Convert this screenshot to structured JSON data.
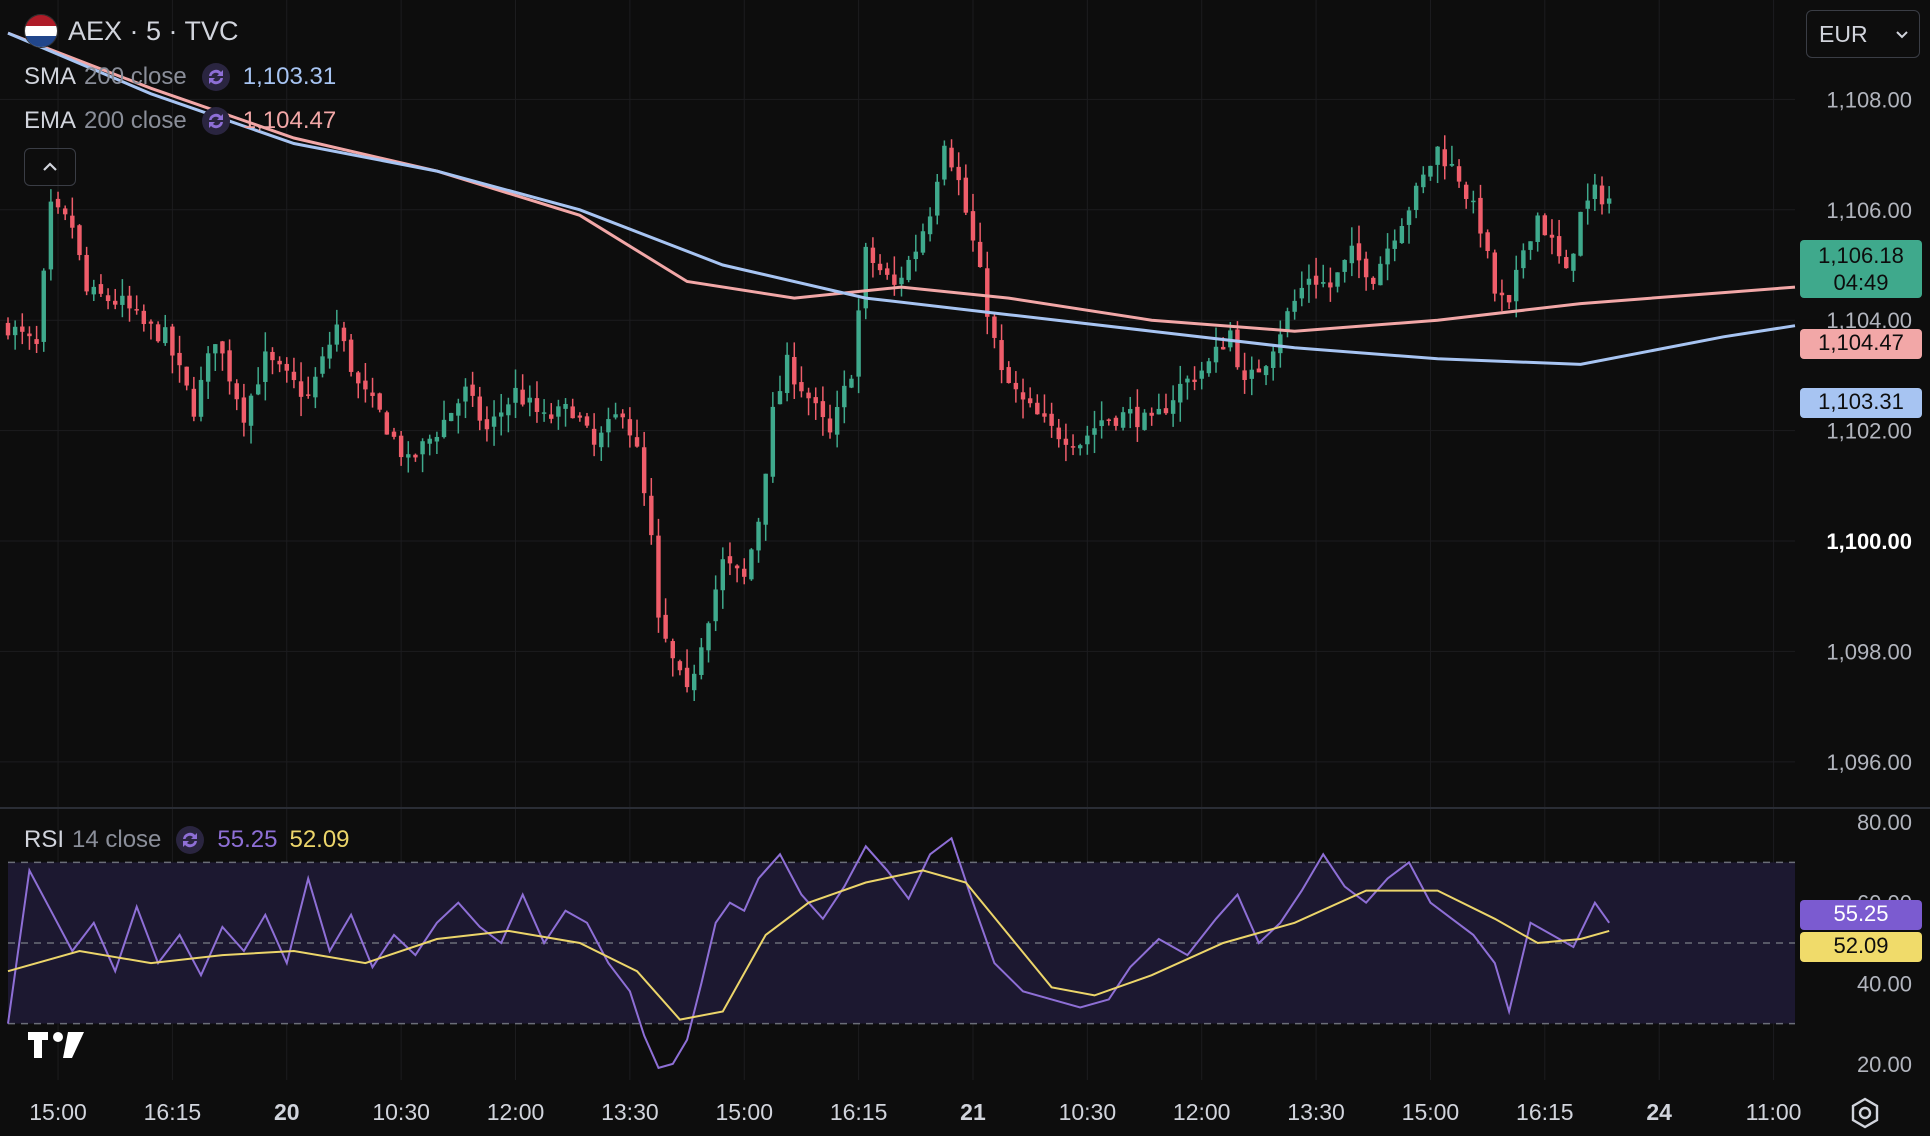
{
  "header": {
    "symbol_title": "AEX · 5 · TVC",
    "flag_icon": "netherlands-flag-icon",
    "currency_label": "EUR"
  },
  "indicators": {
    "sma": {
      "name": "SMA",
      "params": "200 close",
      "value": "1,103.31",
      "color": "#a7c4f2"
    },
    "ema": {
      "name": "EMA",
      "params": "200 close",
      "value": "1,104.47",
      "color": "#f2a7a7"
    },
    "rsi": {
      "name": "RSI",
      "params": "14 close",
      "value": "55.25",
      "ma_value": "52.09",
      "color": "#8e6fd6",
      "ma_color": "#ecd56a"
    }
  },
  "price_tags": {
    "last_price": "1,106.18",
    "countdown": "04:49",
    "ema": "1,104.47",
    "sma": "1,103.31",
    "rsi": "55.25",
    "rsi_ma": "52.09"
  },
  "colors": {
    "up": "#3fa98c",
    "down": "#ef5d6a",
    "sma": "#a7c4f2",
    "ema": "#f2a7a7",
    "rsi": "#8e6fd6",
    "rsi_ma": "#ecd56a",
    "background": "#0d0d0d",
    "grid": "#1c1c1f"
  },
  "chart_data": [
    {
      "type": "candlestick",
      "title": "AEX · 5 · TVC",
      "y_axis": {
        "ylim": [
          1095.2,
          1109.8
        ],
        "ticks": [
          "1,096.00",
          "1,098.00",
          "1,100.00",
          "1,102.00",
          "1,104.00",
          "1,106.00",
          "1,108.00"
        ],
        "tick_values": [
          1096,
          1098,
          1100,
          1102,
          1104,
          1106,
          1108
        ],
        "bold_tick": "1,100.00"
      },
      "x_axis": {
        "ticks": [
          "15:00",
          "16:15",
          "20",
          "10:30",
          "12:00",
          "13:30",
          "15:00",
          "16:15",
          "21",
          "10:30",
          "12:00",
          "13:30",
          "15:00",
          "16:15",
          "24",
          "11:00"
        ],
        "tick_positions": [
          7,
          23,
          39,
          55,
          71,
          87,
          103,
          119,
          135,
          151,
          167,
          183,
          199,
          215,
          231,
          247
        ],
        "bold_ticks": [
          "20",
          "21",
          "24"
        ]
      },
      "ohlc_close_path": [
        [
          0,
          1103.9
        ],
        [
          4,
          1103.5
        ],
        [
          6,
          1106.0
        ],
        [
          9,
          1105.7
        ],
        [
          11,
          1104.5
        ],
        [
          16,
          1104.3
        ],
        [
          19,
          1103.9
        ],
        [
          22,
          1103.7
        ],
        [
          26,
          1102.4
        ],
        [
          29,
          1103.7
        ],
        [
          33,
          1102.3
        ],
        [
          36,
          1103.3
        ],
        [
          42,
          1102.6
        ],
        [
          46,
          1103.9
        ],
        [
          49,
          1102.8
        ],
        [
          52,
          1102.3
        ],
        [
          56,
          1101.4
        ],
        [
          60,
          1102.0
        ],
        [
          64,
          1102.7
        ],
        [
          67,
          1102.0
        ],
        [
          71,
          1102.7
        ],
        [
          75,
          1102.2
        ],
        [
          79,
          1102.4
        ],
        [
          82,
          1101.7
        ],
        [
          86,
          1102.4
        ],
        [
          88,
          1101.6
        ],
        [
          90,
          1100.0
        ],
        [
          91,
          1098.5
        ],
        [
          93,
          1097.8
        ],
        [
          95,
          1097.2
        ],
        [
          97,
          1098.2
        ],
        [
          100,
          1099.6
        ],
        [
          103,
          1099.3
        ],
        [
          105,
          1100.4
        ],
        [
          107,
          1102.3
        ],
        [
          109,
          1103.2
        ],
        [
          112,
          1102.6
        ],
        [
          115,
          1101.9
        ],
        [
          118,
          1103.1
        ],
        [
          120,
          1105.2
        ],
        [
          124,
          1104.6
        ],
        [
          127,
          1105.3
        ],
        [
          129,
          1106.0
        ],
        [
          131,
          1107.3
        ],
        [
          133,
          1106.5
        ],
        [
          135,
          1105.4
        ],
        [
          137,
          1104.2
        ],
        [
          139,
          1103.0
        ],
        [
          142,
          1102.5
        ],
        [
          146,
          1102.0
        ],
        [
          150,
          1101.8
        ],
        [
          153,
          1102.2
        ],
        [
          157,
          1102.3
        ],
        [
          160,
          1102.1
        ],
        [
          164,
          1102.8
        ],
        [
          168,
          1103.2
        ],
        [
          171,
          1103.8
        ],
        [
          173,
          1102.8
        ],
        [
          176,
          1103.3
        ],
        [
          179,
          1104.1
        ],
        [
          182,
          1104.8
        ],
        [
          185,
          1104.6
        ],
        [
          188,
          1105.2
        ],
        [
          191,
          1104.8
        ],
        [
          194,
          1105.6
        ],
        [
          197,
          1106.3
        ],
        [
          200,
          1107.1
        ],
        [
          203,
          1106.6
        ],
        [
          206,
          1105.7
        ],
        [
          208,
          1104.5
        ],
        [
          210,
          1104.2
        ],
        [
          212,
          1105.3
        ],
        [
          214,
          1105.9
        ],
        [
          216,
          1105.4
        ],
        [
          218,
          1104.8
        ],
        [
          220,
          1105.9
        ],
        [
          222,
          1106.3
        ],
        [
          224,
          1106.2
        ]
      ],
      "sma_200": [
        [
          0,
          1109.2
        ],
        [
          20,
          1108.1
        ],
        [
          40,
          1107.2
        ],
        [
          60,
          1106.7
        ],
        [
          80,
          1106.0
        ],
        [
          100,
          1105.0
        ],
        [
          120,
          1104.4
        ],
        [
          140,
          1104.1
        ],
        [
          160,
          1103.8
        ],
        [
          180,
          1103.5
        ],
        [
          200,
          1103.3
        ],
        [
          220,
          1103.2
        ],
        [
          240,
          1103.7
        ],
        [
          250,
          1103.9
        ]
      ],
      "ema_200": [
        [
          0,
          1109.2
        ],
        [
          20,
          1108.2
        ],
        [
          40,
          1107.3
        ],
        [
          60,
          1106.7
        ],
        [
          80,
          1105.9
        ],
        [
          95,
          1104.7
        ],
        [
          110,
          1104.4
        ],
        [
          125,
          1104.6
        ],
        [
          140,
          1104.4
        ],
        [
          160,
          1104.0
        ],
        [
          180,
          1103.8
        ],
        [
          200,
          1104.0
        ],
        [
          220,
          1104.3
        ],
        [
          240,
          1104.5
        ],
        [
          250,
          1104.6
        ]
      ]
    },
    {
      "type": "line",
      "title": "RSI 14 close",
      "y_axis": {
        "ylim": [
          16,
          83
        ],
        "ticks": [
          "20.00",
          "40.00",
          "60.00",
          "80.00"
        ],
        "tick_values": [
          20,
          40,
          60,
          80
        ],
        "bands": [
          30,
          50,
          70
        ]
      },
      "series": [
        {
          "name": "RSI",
          "points": [
            [
              0,
              30
            ],
            [
              3,
              68
            ],
            [
              6,
              58
            ],
            [
              9,
              48
            ],
            [
              12,
              55
            ],
            [
              15,
              43
            ],
            [
              18,
              59
            ],
            [
              21,
              45
            ],
            [
              24,
              52
            ],
            [
              27,
              42
            ],
            [
              30,
              54
            ],
            [
              33,
              48
            ],
            [
              36,
              57
            ],
            [
              39,
              45
            ],
            [
              42,
              66
            ],
            [
              45,
              48
            ],
            [
              48,
              57
            ],
            [
              51,
              44
            ],
            [
              54,
              52
            ],
            [
              57,
              47
            ],
            [
              60,
              55
            ],
            [
              63,
              60
            ],
            [
              66,
              54
            ],
            [
              69,
              50
            ],
            [
              72,
              62
            ],
            [
              75,
              50
            ],
            [
              78,
              58
            ],
            [
              81,
              55
            ],
            [
              84,
              45
            ],
            [
              87,
              38
            ],
            [
              89,
              27
            ],
            [
              91,
              19
            ],
            [
              93,
              20
            ],
            [
              95,
              26
            ],
            [
              97,
              40
            ],
            [
              99,
              55
            ],
            [
              101,
              60
            ],
            [
              103,
              58
            ],
            [
              105,
              66
            ],
            [
              108,
              72
            ],
            [
              111,
              62
            ],
            [
              114,
              56
            ],
            [
              117,
              64
            ],
            [
              120,
              74
            ],
            [
              123,
              68
            ],
            [
              126,
              61
            ],
            [
              129,
              72
            ],
            [
              132,
              76
            ],
            [
              135,
              60
            ],
            [
              138,
              45
            ],
            [
              142,
              38
            ],
            [
              146,
              36
            ],
            [
              150,
              34
            ],
            [
              154,
              36
            ],
            [
              157,
              44
            ],
            [
              161,
              51
            ],
            [
              165,
              47
            ],
            [
              169,
              56
            ],
            [
              172,
              62
            ],
            [
              175,
              50
            ],
            [
              178,
              55
            ],
            [
              181,
              63
            ],
            [
              184,
              72
            ],
            [
              187,
              64
            ],
            [
              190,
              60
            ],
            [
              193,
              66
            ],
            [
              196,
              70
            ],
            [
              199,
              60
            ],
            [
              202,
              56
            ],
            [
              205,
              52
            ],
            [
              208,
              45
            ],
            [
              210,
              33
            ],
            [
              213,
              55
            ],
            [
              216,
              52
            ],
            [
              219,
              49
            ],
            [
              222,
              60
            ],
            [
              224,
              55
            ]
          ]
        },
        {
          "name": "RSI MA",
          "points": [
            [
              0,
              43
            ],
            [
              10,
              48
            ],
            [
              20,
              45
            ],
            [
              30,
              47
            ],
            [
              40,
              48
            ],
            [
              50,
              45
            ],
            [
              60,
              51
            ],
            [
              70,
              53
            ],
            [
              80,
              50
            ],
            [
              88,
              43
            ],
            [
              94,
              31
            ],
            [
              100,
              33
            ],
            [
              106,
              52
            ],
            [
              112,
              60
            ],
            [
              120,
              65
            ],
            [
              128,
              68
            ],
            [
              134,
              65
            ],
            [
              140,
              52
            ],
            [
              146,
              39
            ],
            [
              152,
              37
            ],
            [
              160,
              42
            ],
            [
              170,
              50
            ],
            [
              180,
              55
            ],
            [
              190,
              63
            ],
            [
              200,
              63
            ],
            [
              208,
              56
            ],
            [
              214,
              50
            ],
            [
              220,
              51
            ],
            [
              224,
              53
            ]
          ]
        }
      ]
    }
  ]
}
